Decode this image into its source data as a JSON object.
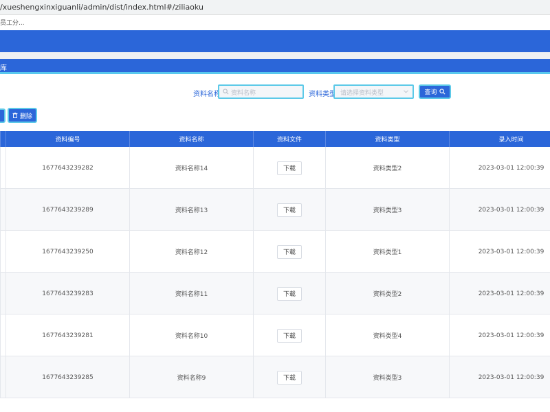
{
  "browser": {
    "url": "/xueshengxinxiguanli/admin/dist/index.html#/ziliaoku",
    "bookmark": "员工分..."
  },
  "breadcrumb": "库",
  "search": {
    "name_label": "资料名称",
    "name_placeholder": "资料名称",
    "type_label": "资料类型",
    "type_placeholder": "请选择资料类型",
    "query_button": "查询"
  },
  "actions": {
    "delete_button": "删除"
  },
  "table": {
    "headers": [
      "资料编号",
      "资料名称",
      "资料文件",
      "资料类型",
      "录入时间"
    ],
    "download_label": "下载",
    "rows": [
      {
        "code": "1677643239282",
        "name": "资料名称14",
        "type": "资料类型2",
        "time": "2023-03-01 12:00:39"
      },
      {
        "code": "1677643239289",
        "name": "资料名称13",
        "type": "资料类型3",
        "time": "2023-03-01 12:00:39"
      },
      {
        "code": "1677643239250",
        "name": "资料名称12",
        "type": "资料类型1",
        "time": "2023-03-01 12:00:39"
      },
      {
        "code": "1677643239283",
        "name": "资料名称11",
        "type": "资料类型2",
        "time": "2023-03-01 12:00:39"
      },
      {
        "code": "1677643239281",
        "name": "资料名称10",
        "type": "资料类型4",
        "time": "2023-03-01 12:00:39"
      },
      {
        "code": "1677643239285",
        "name": "资料名称9",
        "type": "资料类型3",
        "time": "2023-03-01 12:00:39"
      }
    ]
  },
  "colors": {
    "primary": "#2b66d9",
    "accent": "#5cc9e8"
  }
}
